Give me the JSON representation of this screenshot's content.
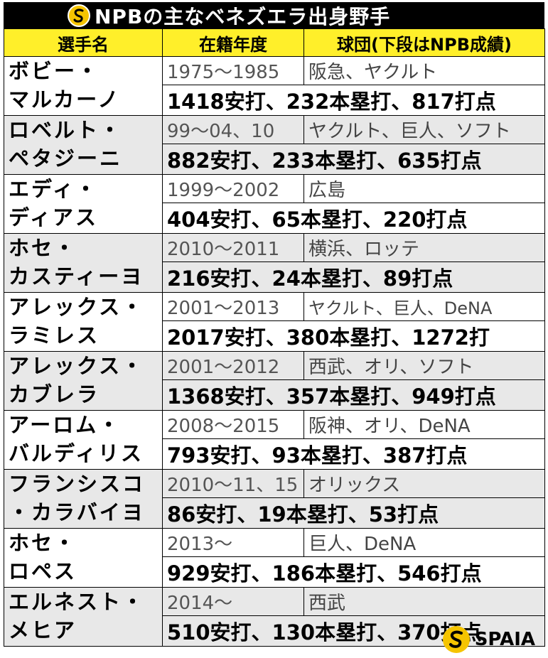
{
  "title": "NPBの主なベネズエラ出身野手",
  "headers": {
    "name": "選手名",
    "years": "在籍年度",
    "teams": "球団(下段はNPB成績)"
  },
  "players": [
    {
      "name1": "ボビー・",
      "name2": "マルカーノ",
      "years": "1975〜1985",
      "teams": "阪急、ヤクルト",
      "stats": "1418安打、232本塁打、817打点"
    },
    {
      "name1": "ロベルト・",
      "name2": "ペタジーニ",
      "years": "99〜04、10",
      "teams": "ヤクルト、巨人、ソフト",
      "stats": "882安打、233本塁打、635打点"
    },
    {
      "name1": "エディ・",
      "name2": "ディアス",
      "years": "1999〜2002",
      "teams": "広島",
      "stats": "404安打、65本塁打、220打点"
    },
    {
      "name1": "ホセ・",
      "name2": "カスティーヨ",
      "years": "2010〜2011",
      "teams": "横浜、ロッテ",
      "stats": "216安打、24本塁打、89打点"
    },
    {
      "name1": "アレックス・",
      "name2": "ラミレス",
      "years": "2001〜2013",
      "teams": "ヤクルト、巨人、DeNA",
      "stats": "2017安打、380本塁打、1272打"
    },
    {
      "name1": "アレックス・",
      "name2": "カブレラ",
      "years": "2001〜2012",
      "teams": "西武、オリ、ソフト",
      "stats": "1368安打、357本塁打、949打点"
    },
    {
      "name1": "アーロム・",
      "name2": "バルディリス",
      "years": "2008〜2015",
      "teams": "阪神、オリ、DeNA",
      "stats": "793安打、93本塁打、387打点"
    },
    {
      "name1": "フランシスコ",
      "name2": "・カラバイヨ",
      "years": "2010〜11、15",
      "teams": "オリックス",
      "stats": "86安打、19本塁打、53打点"
    },
    {
      "name1": "ホセ・",
      "name2": "ロペス",
      "years": "2013〜",
      "teams": "巨人、DeNA",
      "stats": "929安打、186本塁打、546打点"
    },
    {
      "name1": "エルネスト・",
      "name2": "メヒア",
      "years": "2014〜",
      "teams": "西武",
      "stats": "510安打、130本塁打、370打点"
    }
  ],
  "footer": {
    "brand": "SPAIA"
  },
  "colors": {
    "header_bg": "#ffef2a",
    "title_bg": "#000000",
    "row_gray": "#e8e8e8",
    "logo_yellow": "#f5c400"
  }
}
